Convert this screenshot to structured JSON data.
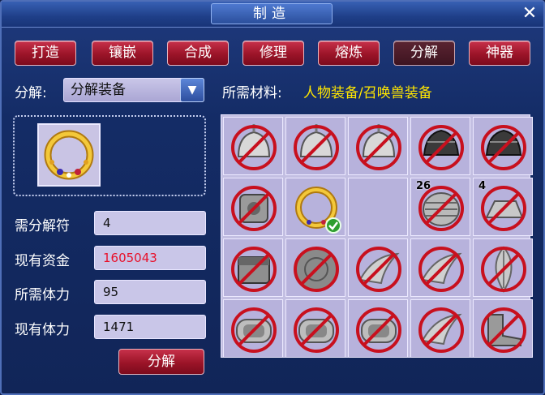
{
  "window": {
    "title": "制造",
    "close_glyph": "✕"
  },
  "tabs": [
    {
      "label": "打造",
      "active": false
    },
    {
      "label": "镶嵌",
      "active": false
    },
    {
      "label": "合成",
      "active": false
    },
    {
      "label": "修理",
      "active": false
    },
    {
      "label": "熔炼",
      "active": false
    },
    {
      "label": "分解",
      "active": true
    },
    {
      "label": "神器",
      "active": false
    }
  ],
  "decompose": {
    "label": "分解:",
    "selected": "分解装备",
    "dropdown_icon": "chevron-down-icon"
  },
  "materials": {
    "label": "所需材料:",
    "value": "人物装备/召唤兽装备"
  },
  "selected_item": {
    "icon": "jeweled-ring-icon"
  },
  "fields": [
    {
      "label": "需分解符",
      "value": "4"
    },
    {
      "label": "现有资金",
      "value": "1605043"
    },
    {
      "label": "所需体力",
      "value": "95"
    },
    {
      "label": "现有体力",
      "value": "1471"
    }
  ],
  "action_button": {
    "label": "分解"
  },
  "colors": {
    "tab_red": "#9b1428",
    "materials_yellow": "#ffe600",
    "money_red": "#e8102a",
    "grid_bg": "#c3bfe2"
  },
  "inventory": [
    {
      "icon": "helmet-icon",
      "blocked": true,
      "count": ""
    },
    {
      "icon": "helmet-icon",
      "blocked": true,
      "count": ""
    },
    {
      "icon": "helmet-icon",
      "blocked": true,
      "count": ""
    },
    {
      "icon": "dark-helmet-icon",
      "blocked": true,
      "count": ""
    },
    {
      "icon": "dark-helmet-icon",
      "blocked": true,
      "count": ""
    },
    {
      "icon": "gauntlet-icon",
      "blocked": true,
      "count": ""
    },
    {
      "icon": "jeweled-ring-icon",
      "blocked": false,
      "selected": true,
      "count": ""
    },
    {
      "icon": "empty-slot",
      "blocked": false,
      "count": ""
    },
    {
      "icon": "scroll-bundle-icon",
      "blocked": true,
      "count": "26"
    },
    {
      "icon": "ingot-icon",
      "blocked": true,
      "count": "4"
    },
    {
      "icon": "chest-icon",
      "blocked": true,
      "count": ""
    },
    {
      "icon": "stone-disc-icon",
      "blocked": true,
      "count": ""
    },
    {
      "icon": "claw-weapon-icon",
      "blocked": true,
      "count": ""
    },
    {
      "icon": "claw-weapon-icon",
      "blocked": true,
      "count": ""
    },
    {
      "icon": "feather-icon",
      "blocked": true,
      "count": ""
    },
    {
      "icon": "bracer-icon",
      "blocked": true,
      "count": ""
    },
    {
      "icon": "bracer-icon",
      "blocked": true,
      "count": ""
    },
    {
      "icon": "bracer-icon",
      "blocked": true,
      "count": ""
    },
    {
      "icon": "claw-weapon-icon",
      "blocked": true,
      "count": ""
    },
    {
      "icon": "boots-icon",
      "blocked": true,
      "count": ""
    }
  ]
}
